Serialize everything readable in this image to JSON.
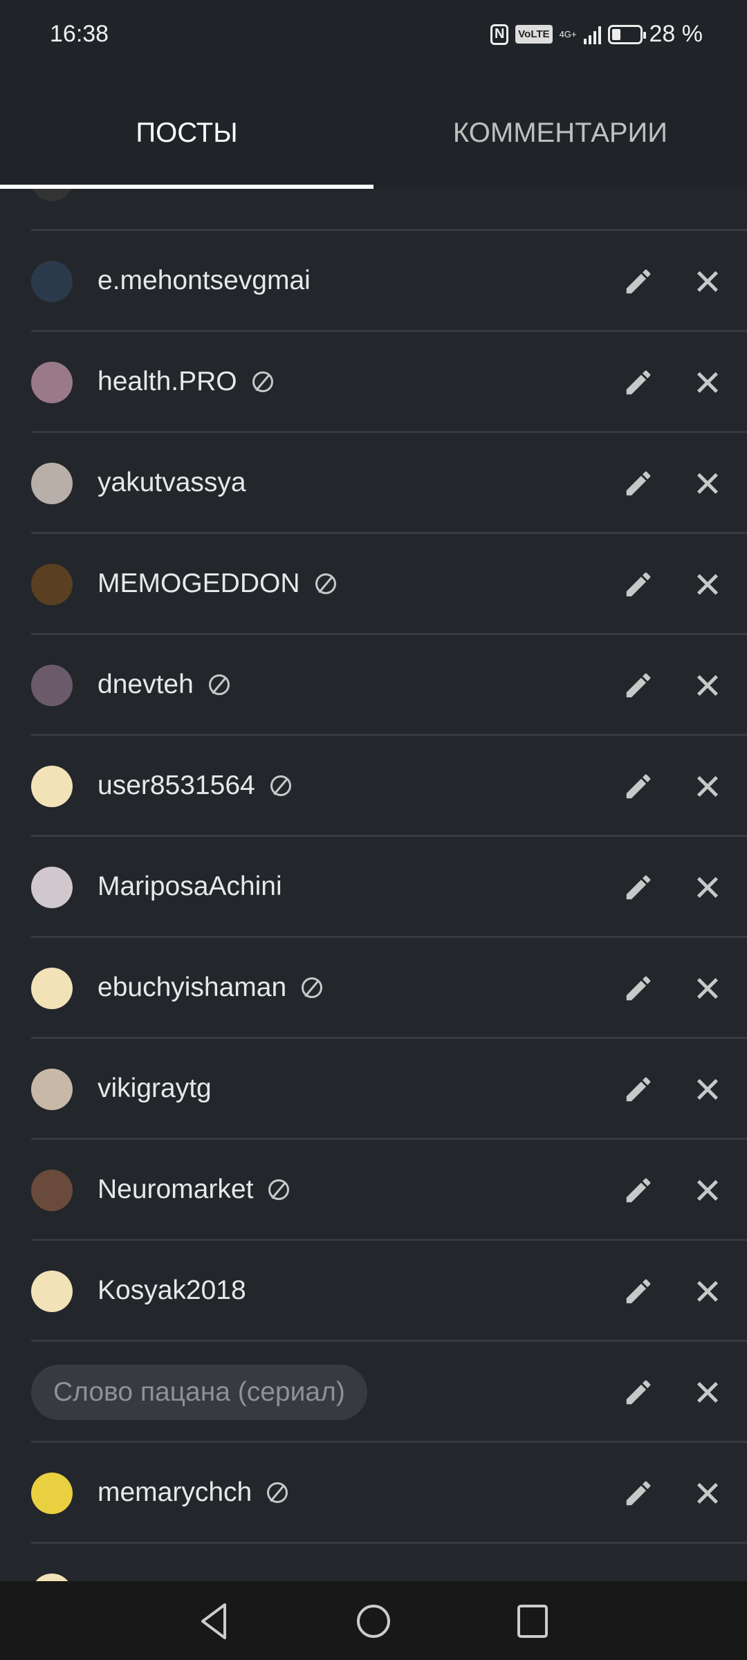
{
  "status_bar": {
    "time": "16:38",
    "nfc": "N",
    "volte": "VoLTE",
    "network": "4G+",
    "battery_percent": 28,
    "battery_label": "28 %"
  },
  "tabs": [
    {
      "label": "ПОСТЫ",
      "active": true
    },
    {
      "label": "КОММЕНТАРИИ",
      "active": false
    }
  ],
  "rows": [
    {
      "type": "user",
      "name": "e.mehontsevgmai",
      "banned": false,
      "avatar_color": "#2a3a4a"
    },
    {
      "type": "user",
      "name": "health.PRO",
      "banned": true,
      "avatar_color": "#9a7a88"
    },
    {
      "type": "user",
      "name": "yakutvassya",
      "banned": false,
      "avatar_color": "#b8b0a8"
    },
    {
      "type": "user",
      "name": "MEMOGEDDON",
      "banned": true,
      "avatar_color": "#5a4020"
    },
    {
      "type": "user",
      "name": "dnevteh",
      "banned": true,
      "avatar_color": "#6a5a6a"
    },
    {
      "type": "user",
      "name": "user8531564",
      "banned": true,
      "avatar_color": "#f2e2b8"
    },
    {
      "type": "user",
      "name": "MariposaAchini",
      "banned": false,
      "avatar_color": "#d0c8cc"
    },
    {
      "type": "user",
      "name": "ebuchyishaman",
      "banned": true,
      "avatar_color": "#f2e2b8"
    },
    {
      "type": "user",
      "name": "vikigraytg",
      "banned": false,
      "avatar_color": "#c8b8a8"
    },
    {
      "type": "user",
      "name": "Neuromarket",
      "banned": true,
      "avatar_color": "#6a4a3a"
    },
    {
      "type": "user",
      "name": "Kosyak2018",
      "banned": false,
      "avatar_color": "#f2e2b8"
    },
    {
      "type": "tag",
      "name": "Слово пацана (сериал)"
    },
    {
      "type": "user",
      "name": "memarychch",
      "banned": true,
      "avatar_color": "#e8d040"
    }
  ],
  "icons": {
    "edit": "pencil-icon",
    "delete": "close-icon",
    "banned": "block-icon"
  },
  "nav": [
    "back-icon",
    "home-icon",
    "recents-icon"
  ]
}
